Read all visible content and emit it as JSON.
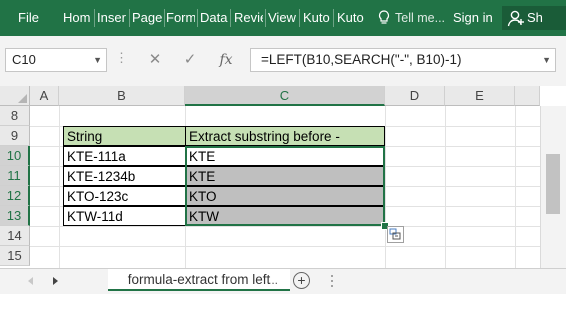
{
  "ribbon": {
    "tabs": [
      "File",
      "Hom",
      "Inser",
      "Page",
      "Form",
      "Data",
      "Revie",
      "View",
      "Kuto",
      "Kuto"
    ],
    "tell_me": "Tell me...",
    "sign_in": "Sign in",
    "share": "Sh",
    "bg_color": "#217346"
  },
  "formula_bar": {
    "name_box": "C10",
    "cancel_symbol": "✕",
    "enter_symbol": "✓",
    "fx_symbol": "fx",
    "formula": "=LEFT(B10,SEARCH(\"-\", B10)-1)"
  },
  "columns": [
    "A",
    "B",
    "C",
    "D",
    "E"
  ],
  "selected_column": "C",
  "rows": [
    "8",
    "9",
    "10",
    "11",
    "12",
    "13",
    "14",
    "15"
  ],
  "selected_rows": [
    "10",
    "11",
    "12",
    "13"
  ],
  "table": {
    "headers": [
      "String",
      "Extract substring before -"
    ],
    "data": [
      [
        "KTE-111a",
        "KTE"
      ],
      [
        "KTE-1234b",
        "KTE"
      ],
      [
        "KTO-123c",
        "KTO"
      ],
      [
        "KTW-11d",
        "KTW"
      ]
    ]
  },
  "sheet": {
    "tab_name": "formula-extract from left",
    "ellipsis": "...",
    "add_symbol": "+"
  },
  "colors": {
    "header_fill": "#c6e0b4",
    "selected_fill": "#bfbfbf",
    "accent": "#217346"
  }
}
